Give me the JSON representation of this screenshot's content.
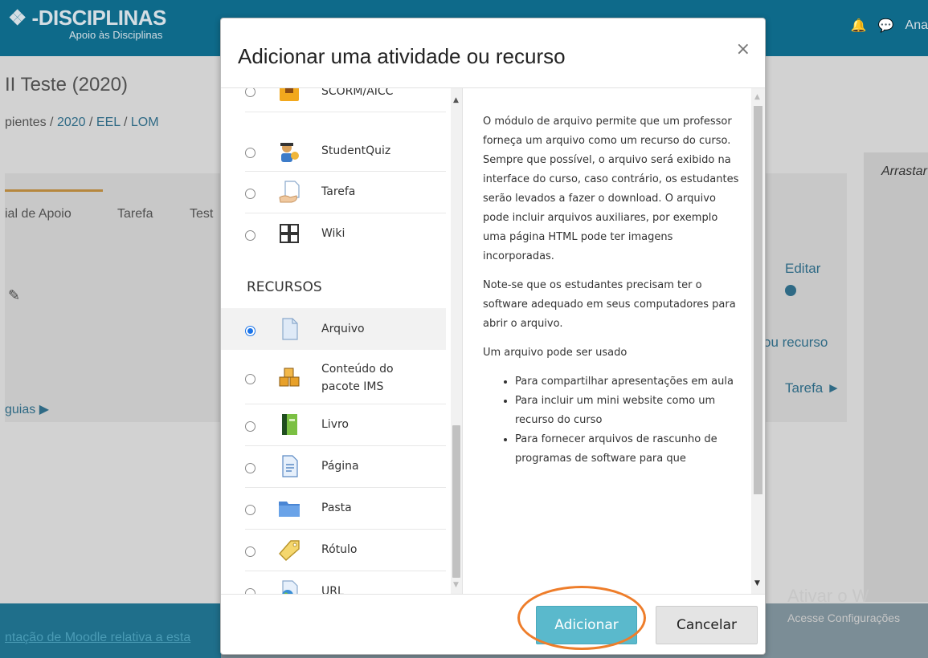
{
  "background": {
    "logo": {
      "title": "-DISCIPLINAS",
      "subtitle": "Apoio às Disciplinas"
    },
    "user_name": "Ana",
    "course_title": "II Teste (2020)",
    "breadcrumb": {
      "prefix": "pientes /",
      "year": "2020",
      "sep1": "/",
      "school": "EEL",
      "sep2": "/",
      "dept": "LOM"
    },
    "tabs": [
      "ial de Apoio",
      "Tarefa",
      "Test"
    ],
    "right_panel": {
      "drag_label": "Arrastar",
      "edit_link": "Editar",
      "add_resource": "ou recurso",
      "next_link": "Tarefa ►"
    },
    "guias_link": "guias ▶",
    "footer_link": "ntação de Moodle relativa a esta",
    "watermark": {
      "line1": "Ativar o W",
      "line2": "Acesse Configurações"
    }
  },
  "modal": {
    "title": "Adicionar uma atividade ou recurso",
    "close": "×",
    "activities": [
      {
        "label": "SCORM/AICC",
        "icon": "scorm-icon"
      },
      {
        "label": "StudentQuiz",
        "icon": "studentquiz-icon"
      },
      {
        "label": "Tarefa",
        "icon": "assignment-icon"
      },
      {
        "label": "Wiki",
        "icon": "wiki-icon"
      }
    ],
    "resources_heading": "RECURSOS",
    "resources": [
      {
        "label": "Arquivo",
        "icon": "file-icon",
        "selected": true
      },
      {
        "label": "Conteúdo do pacote IMS",
        "line1": "Conteúdo do",
        "line2": "pacote IMS",
        "icon": "ims-package-icon"
      },
      {
        "label": "Livro",
        "icon": "book-icon"
      },
      {
        "label": "Página",
        "icon": "page-icon"
      },
      {
        "label": "Pasta",
        "icon": "folder-icon"
      },
      {
        "label": "Rótulo",
        "icon": "label-tag-icon"
      },
      {
        "label": "URL",
        "icon": "url-globe-icon"
      }
    ],
    "description": {
      "p1": "O módulo de arquivo permite que um professor forneça um arquivo como um recurso do curso. Sempre que possível, o arquivo será exibido na interface do curso, caso contrário, os estudantes serão levados a fazer o download. O arquivo pode incluir arquivos auxiliares, por exemplo uma página HTML pode ter imagens incorporadas.",
      "p2": "Note-se que os estudantes precisam ter o software adequado em seus computadores para abrir o arquivo.",
      "p3": "Um arquivo pode ser usado",
      "bullets": [
        "Para compartilhar apresentações em aula",
        "Para incluir um mini website como um recurso do curso",
        "Para fornecer arquivos de rascunho de programas de software para que"
      ]
    },
    "buttons": {
      "add": "Adicionar",
      "cancel": "Cancelar"
    }
  },
  "colors": {
    "topbar": "#0e6a8a",
    "primary_button": "#5ab9cc",
    "highlight": "#ee7d2a",
    "radio_selected": "#1a73e8"
  }
}
